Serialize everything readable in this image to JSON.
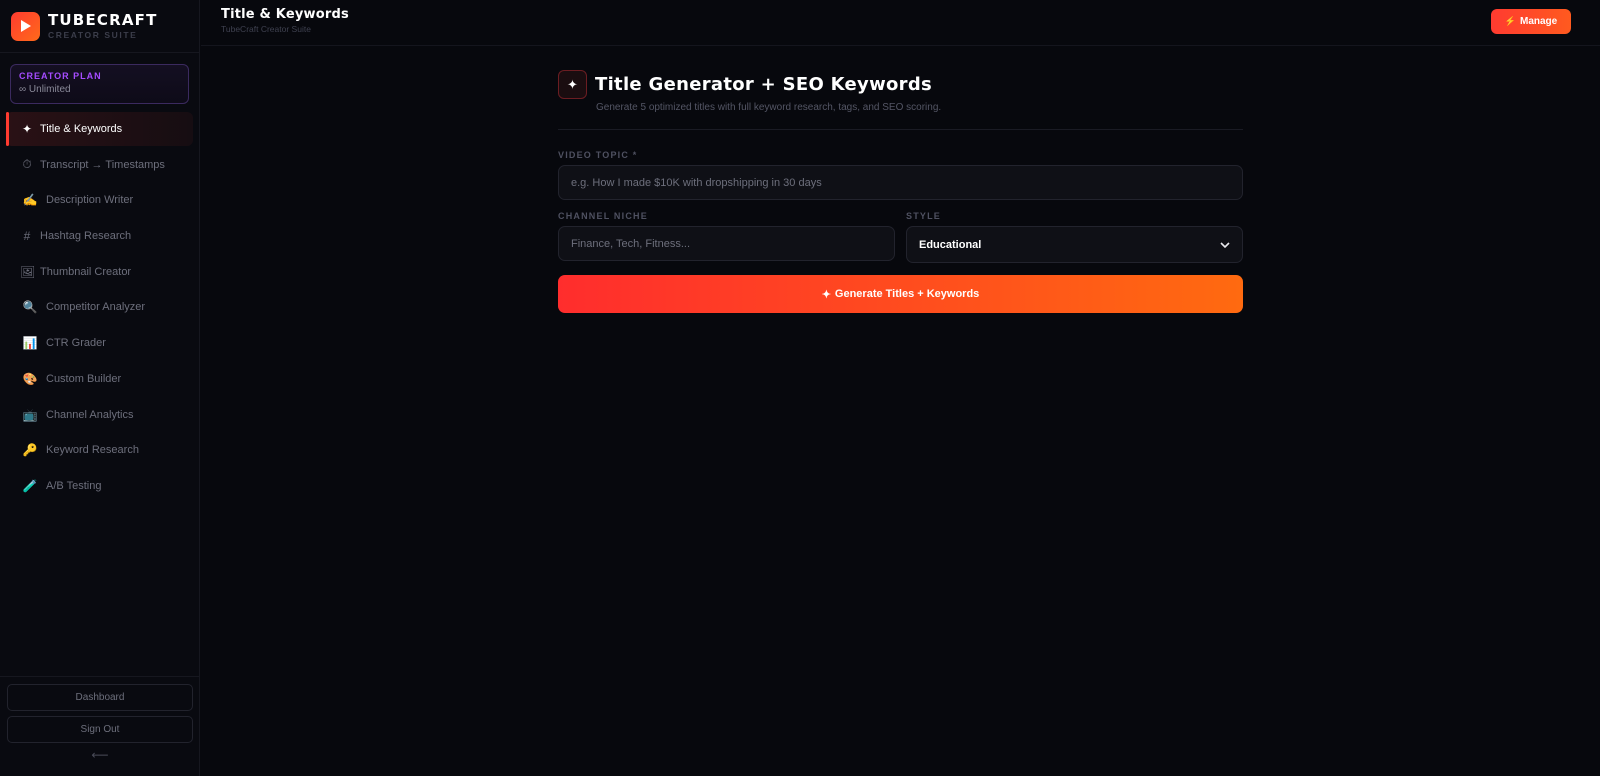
{
  "brand": {
    "name": "TUBECRAFT",
    "subtitle": "CREATOR SUITE"
  },
  "plan": {
    "title": "CREATOR PLAN",
    "value": "∞ Unlimited"
  },
  "sidebar": {
    "items": [
      {
        "icon": "✦",
        "label": "Title & Keywords",
        "active": true
      },
      {
        "icon": "⏱",
        "label": "Transcript → Timestamps"
      },
      {
        "icon": "✍️",
        "label": "Description Writer"
      },
      {
        "icon": "#",
        "label": "Hashtag Research"
      },
      {
        "icon": "🖼",
        "label": "Thumbnail Creator"
      },
      {
        "icon": "🔍",
        "label": "Competitor Analyzer"
      },
      {
        "icon": "📊",
        "label": "CTR Grader"
      },
      {
        "icon": "🎨",
        "label": "Custom Builder"
      },
      {
        "icon": "📺",
        "label": "Channel Analytics"
      },
      {
        "icon": "🔑",
        "label": "Keyword Research"
      },
      {
        "icon": "🧪",
        "label": "A/B Testing"
      }
    ],
    "footer": {
      "dashboard": "Dashboard",
      "sign_out": "Sign Out",
      "collapse": "⟵"
    }
  },
  "topbar": {
    "title": "Title & Keywords",
    "subtitle": "TubeCraft Creator Suite",
    "manage_icon": "⚡",
    "manage_label": "Manage"
  },
  "main": {
    "icon": "✦",
    "title": "Title Generator + SEO Keywords",
    "subtitle": "Generate 5 optimized titles with full keyword research, tags, and SEO scoring.",
    "topic_label": "VIDEO TOPIC *",
    "topic_placeholder": "e.g. How I made $10K with dropshipping in 30 days",
    "niche_label": "CHANNEL NICHE",
    "niche_placeholder": "Finance, Tech, Fitness...",
    "style_label": "STYLE",
    "style_value": "Educational",
    "generate_icon": "✦",
    "generate_label": "Generate Titles + Keywords"
  },
  "colors": {
    "accent": "#ff3b30",
    "accent_end": "#ff6a10",
    "plan_purple": "#a54cff",
    "background": "#07080d"
  }
}
